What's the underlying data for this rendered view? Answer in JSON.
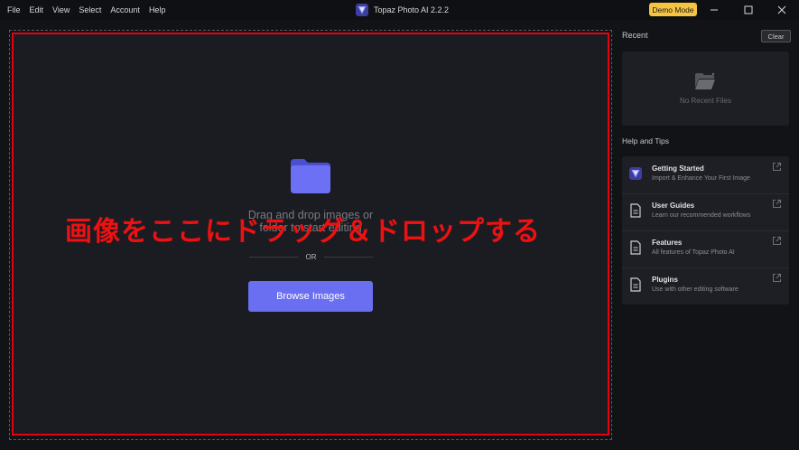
{
  "menu": [
    "File",
    "Edit",
    "View",
    "Select",
    "Account",
    "Help"
  ],
  "app_title": "Topaz Photo AI 2.2.2",
  "demo_badge": "Demo Mode",
  "window_controls": {
    "minimize": "—",
    "maximize": "☐",
    "close": "✕"
  },
  "drop": {
    "line1": "Drag and drop images or",
    "line2": "folder to start editing",
    "or": "OR",
    "browse_label": "Browse Images"
  },
  "overlay_annotation": "画像をここにドラッグ＆ドロップする",
  "recent": {
    "label": "Recent",
    "clear_label": "Clear",
    "empty_text": "No Recent Files"
  },
  "help": {
    "label": "Help and Tips",
    "items": [
      {
        "title": "Getting Started",
        "desc": "Import & Enhance Your First Image",
        "icon": "topaz-logo-icon"
      },
      {
        "title": "User Guides",
        "desc": "Learn our recommended workflows",
        "icon": "document-icon"
      },
      {
        "title": "Features",
        "desc": "All features of Topaz Photo AI",
        "icon": "document-icon"
      },
      {
        "title": "Plugins",
        "desc": "Use with other editing software",
        "icon": "document-icon"
      }
    ]
  },
  "colors": {
    "accent": "#6a6ef0",
    "annotation_red": "#e60012",
    "demo_badge": "#f5c542"
  }
}
